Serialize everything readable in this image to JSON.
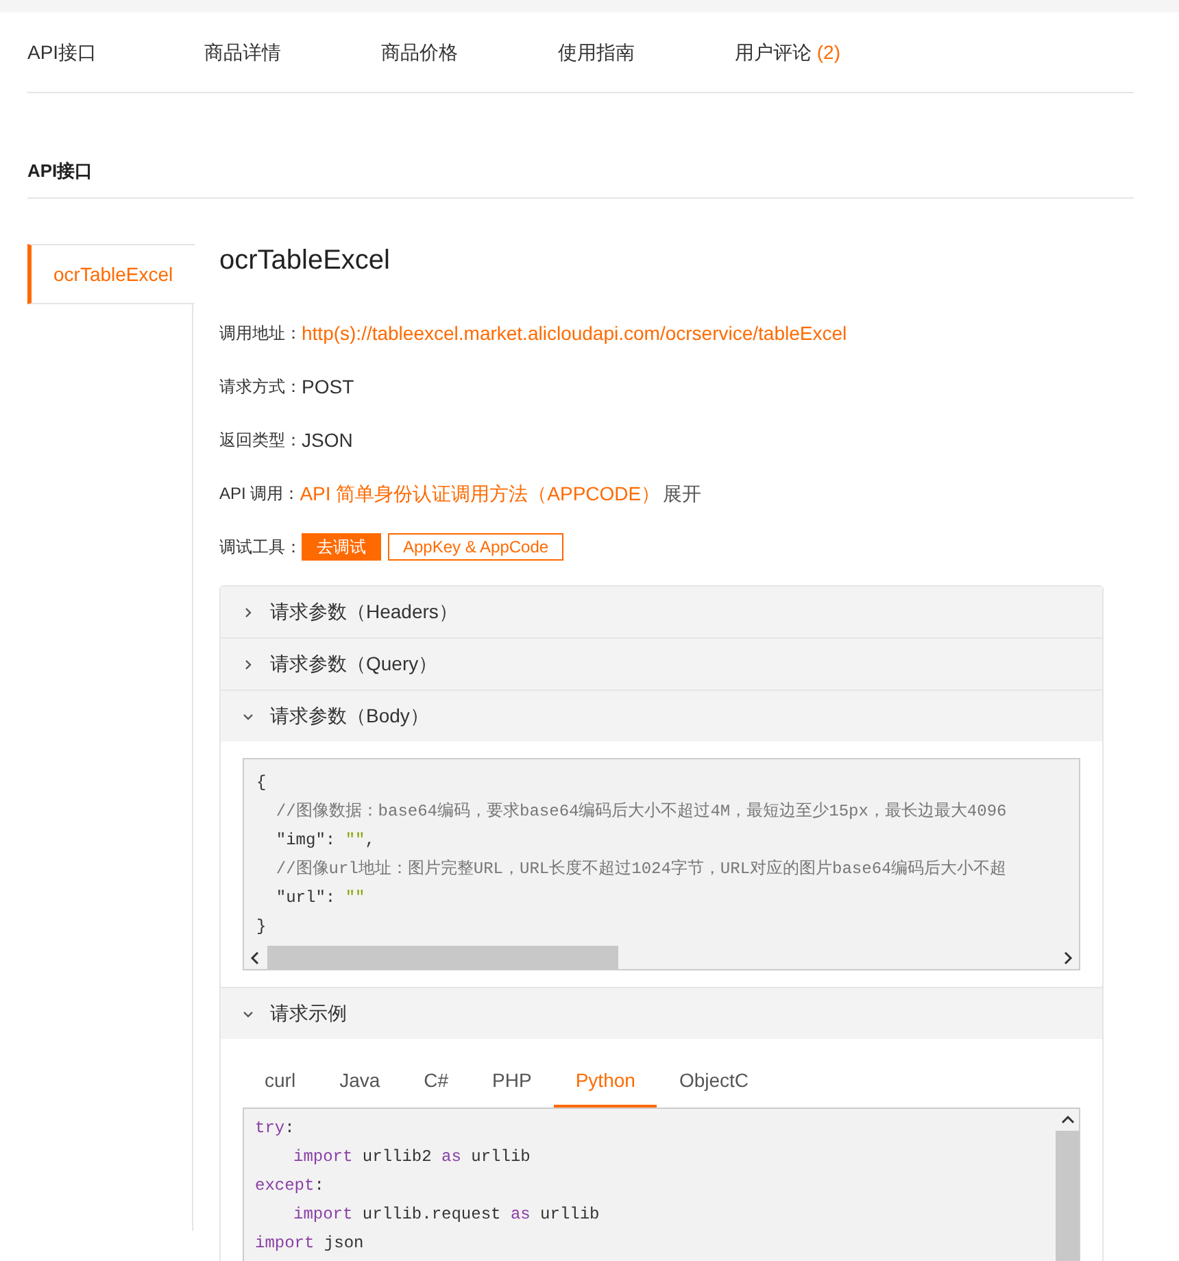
{
  "top_nav": [
    {
      "label": "API接口"
    },
    {
      "label": "商品详情"
    },
    {
      "label": "商品价格"
    },
    {
      "label": "使用指南"
    },
    {
      "label": "用户评论",
      "count": "(2)"
    }
  ],
  "section_title": "API接口",
  "side_tabs": [
    {
      "label": "ocrTableExcel",
      "selected": true
    }
  ],
  "api": {
    "title": "ocrTableExcel",
    "fields": [
      {
        "label": "调用地址：",
        "kind": "link",
        "value": "http(s)://tableexcel.market.alicloudapi.com/ocrservice/tableExcel"
      },
      {
        "label": "请求方式：",
        "kind": "text",
        "value": "POST"
      },
      {
        "label": "返回类型：",
        "kind": "text",
        "value": "JSON"
      },
      {
        "label": "API 调用：",
        "kind": "link",
        "value": "API 简单身份认证调用方法（APPCODE）",
        "suffix": "展开"
      }
    ],
    "tools": {
      "label": "调试工具：",
      "buttons": [
        {
          "label": "去调试",
          "kind": "primary"
        },
        {
          "label": "AppKey & AppCode",
          "kind": "outline"
        }
      ]
    }
  },
  "accordion": [
    {
      "title": "请求参数（Headers）",
      "expanded": false
    },
    {
      "title": "请求参数（Query）",
      "expanded": false
    },
    {
      "title": "请求参数（Body）",
      "expanded": true,
      "code": [
        [
          {
            "kind": "plain",
            "text": "{"
          }
        ],
        [
          {
            "kind": "comment",
            "text": "  //图像数据：base64编码，要求base64编码后大小不超过4M，最短边至少15px，最长边最大4096"
          }
        ],
        [
          {
            "kind": "plain",
            "text": "  \"img\": "
          },
          {
            "kind": "string",
            "text": "\"\""
          },
          {
            "kind": "plain",
            "text": ","
          }
        ],
        [
          {
            "kind": "comment",
            "text": "  //图像url地址：图片完整URL，URL长度不超过1024字节，URL对应的图片base64编码后大小不超"
          }
        ],
        [
          {
            "kind": "plain",
            "text": "  \"url\": "
          },
          {
            "kind": "string",
            "text": "\"\""
          }
        ],
        [
          {
            "kind": "plain",
            "text": "}"
          }
        ]
      ]
    },
    {
      "title": "请求示例",
      "expanded": true,
      "tabs": [
        {
          "label": "curl",
          "selected": false
        },
        {
          "label": "Java",
          "selected": false
        },
        {
          "label": "C#",
          "selected": false
        },
        {
          "label": "PHP",
          "selected": false
        },
        {
          "label": "Python",
          "selected": true
        },
        {
          "label": "ObjectC",
          "selected": false
        }
      ],
      "code": [
        [
          {
            "kind": "keyword",
            "text": "try"
          },
          {
            "kind": "plain",
            "text": ":"
          }
        ],
        [
          {
            "kind": "indent"
          },
          {
            "kind": "keyword",
            "text": "import"
          },
          {
            "kind": "plain",
            "text": " urllib2 "
          },
          {
            "kind": "keyword",
            "text": "as"
          },
          {
            "kind": "plain",
            "text": " urllib"
          }
        ],
        [
          {
            "kind": "keyword",
            "text": "except"
          },
          {
            "kind": "plain",
            "text": ":"
          }
        ],
        [
          {
            "kind": "indent"
          },
          {
            "kind": "keyword",
            "text": "import"
          },
          {
            "kind": "plain",
            "text": " urllib.request "
          },
          {
            "kind": "keyword",
            "text": "as"
          },
          {
            "kind": "plain",
            "text": " urllib"
          }
        ],
        [
          {
            "kind": "keyword",
            "text": "import"
          },
          {
            "kind": "plain",
            "text": " json"
          }
        ]
      ]
    }
  ]
}
